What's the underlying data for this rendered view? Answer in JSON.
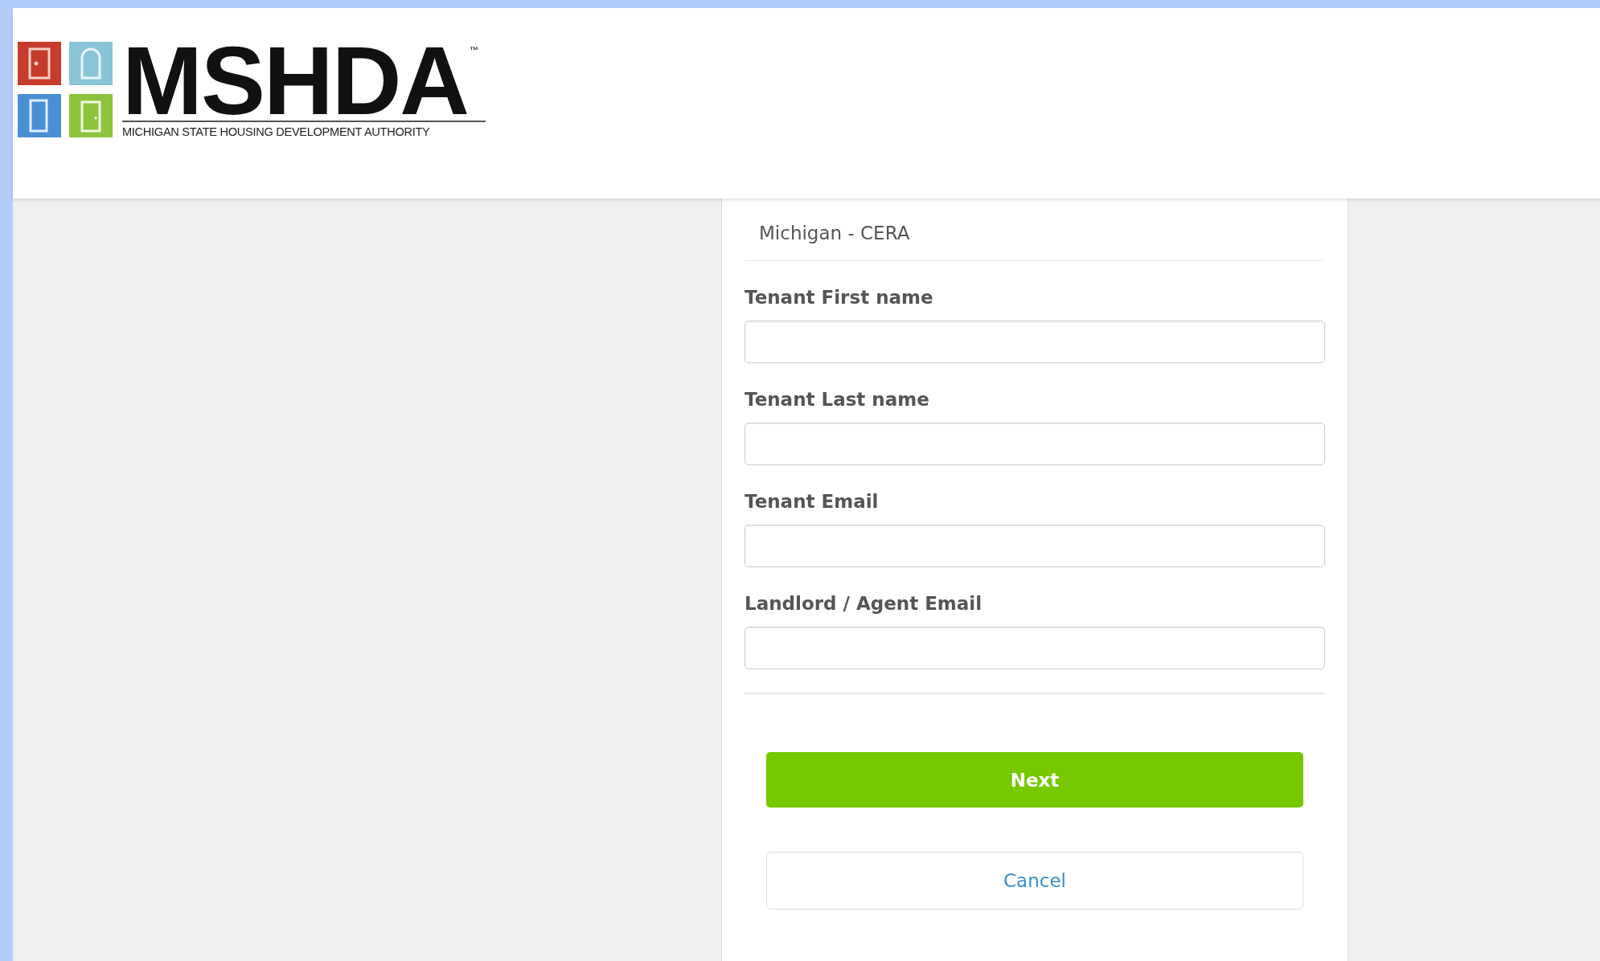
{
  "header": {
    "logo": {
      "wordmark": "MSHDA",
      "trademark": "™",
      "subtitle": "MICHIGAN STATE HOUSING DEVELOPMENT AUTHORITY"
    }
  },
  "form": {
    "title": "Michigan - CERA",
    "fields": [
      {
        "label": "Tenant First name"
      },
      {
        "label": "Tenant Last name"
      },
      {
        "label": "Tenant Email"
      },
      {
        "label": "Landlord / Agent Email"
      }
    ],
    "buttons": [
      {
        "label": "Next",
        "kind": "primary"
      },
      {
        "label": "Cancel",
        "kind": "secondary"
      }
    ]
  }
}
